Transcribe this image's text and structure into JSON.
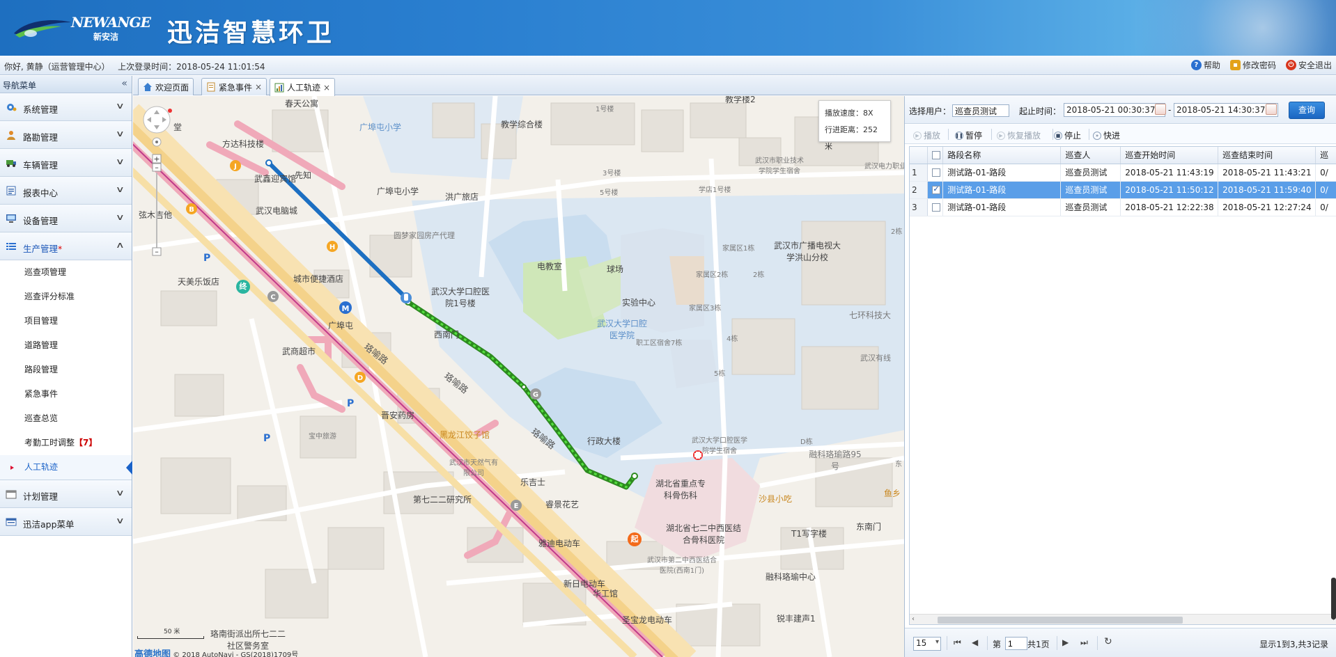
{
  "header": {
    "logo_brand": "NEWANGE",
    "logo_cn": "新安洁",
    "app_title": "迅洁智慧环卫"
  },
  "infobar": {
    "greeting": "你好, 黄静（运营管理中心）",
    "last_login": "上次登录时间：2018-05-24 11:01:54",
    "help": "帮助",
    "change_password": "修改密码",
    "logout": "安全退出"
  },
  "sidebar": {
    "title": "导航菜单",
    "items": [
      {
        "label": "系统管理",
        "icon": "gear-icon"
      },
      {
        "label": "路勘管理",
        "icon": "person-icon"
      },
      {
        "label": "车辆管理",
        "icon": "truck-icon"
      },
      {
        "label": "报表中心",
        "icon": "report-icon"
      },
      {
        "label": "设备管理",
        "icon": "monitor-icon"
      },
      {
        "label": "生产管理",
        "icon": "list-icon",
        "marker": "*"
      }
    ],
    "sub_items": [
      {
        "label": "巡查项管理"
      },
      {
        "label": "巡查评分标准"
      },
      {
        "label": "项目管理"
      },
      {
        "label": "道路管理"
      },
      {
        "label": "路段管理"
      },
      {
        "label": "紧急事件"
      },
      {
        "label": "巡查总览"
      },
      {
        "label": "考勤工时调整",
        "badge": "【7】"
      },
      {
        "label": "人工轨迹"
      }
    ],
    "items_after": [
      {
        "label": "计划管理",
        "icon": "calendar-icon"
      },
      {
        "label": "迅洁app菜单",
        "icon": "app-icon"
      }
    ]
  },
  "tabs": [
    {
      "label": "欢迎页面",
      "closable": false
    },
    {
      "label": "紧急事件",
      "closable": true
    },
    {
      "label": "人工轨迹",
      "closable": true
    }
  ],
  "map": {
    "info": {
      "speed_label": "播放速度：",
      "speed": "8X",
      "distance_label": "行进距离：",
      "distance": "252米"
    },
    "scale": "50 米",
    "copyright_brand": "高德地图",
    "copyright": "© 2018 AutoNavi - GS(2018)1709号",
    "labels": {
      "l1": "方达科技楼",
      "l2": "武鑫迎宾馆",
      "l3": "先知",
      "l4": "武汉电脑城",
      "l5": "弦木吉他",
      "l6": "天美乐饭店",
      "l7": "城市便捷酒店",
      "l8": "广埠屯",
      "l9": "武商超市",
      "l10": "珞喻路",
      "l11": "晋安药房",
      "l12": "宝中旅游",
      "l13": "黑龙江饺子馆",
      "l14": "武汉市天然气有限公司",
      "l15": "第七二二研究所",
      "l16": "乐吉士",
      "l17": "睿景花艺",
      "l18": "雅迪电动车",
      "l19": "新日电动车",
      "l20": "华工馆",
      "l21": "圣宝龙电动车",
      "l22": "珞南街派出所七二二社区警务室",
      "l23": "广埠屯小学",
      "l24": "洪广旅店",
      "l25": "圆梦家园房产代理",
      "l26": "教学综合楼",
      "l27": "春天公寓",
      "l28": "武汉大学口腔医院1号楼",
      "l29": "电教室",
      "l30": "球场",
      "l31": "实验中心",
      "l32": "武汉大学口腔医学院",
      "l33": "西南门",
      "l34": "行政大楼",
      "l35": "湖北省重点专科骨伤科",
      "l36": "湖北省七二中西医结合骨科医院",
      "l37": "武汉市第二中西医结合医院(西南1门)",
      "l38": "沙县小吃",
      "l39": "T1写字楼",
      "l40": "东南门",
      "l41": "融科珞瑜中心",
      "l42": "锐丰建声1",
      "l43": "武汉市广播电视大学洪山分校",
      "l44": "武汉有线",
      "l45": "七环科技大",
      "l46": "融科珞瑜路95号",
      "l47": "武汉市职业技术学院学生宿舍",
      "l48": "家属区1栋",
      "l49": "家属区2栋",
      "l50": "家属区3栋",
      "l51": "职工区宿舍7栋",
      "l52": "武汉大学口腔医学院学生宿舍",
      "l53": "2栋",
      "l54": "4栋",
      "l55": "5栋",
      "l56": "学店1号楼",
      "l57": "3号楼",
      "l58": "5号楼",
      "l59": "1号楼",
      "l60": "教学楼2",
      "l61": "广埠屯小学",
      "l62": "湖北省七二中西医结合骨科医院",
      "l63": "武汉电力职业技术学院",
      "l64": "鱼乡",
      "l65": "东",
      "l66": "D栋",
      "l67": "2栋",
      "l68": "堂"
    },
    "markers": {
      "start": "起",
      "end": "终"
    }
  },
  "query": {
    "user_label": "选择用户：",
    "user_value": "巡查员测试",
    "time_label": "起止时间：",
    "start_time": "2018-05-21 00:30:37",
    "sep": "-",
    "end_time": "2018-05-21 14:30:37",
    "query_button": "查询"
  },
  "playback": {
    "play": "播放",
    "pause": "暂停",
    "resume": "恢复播放",
    "stop": "停止",
    "fast": "快进"
  },
  "grid": {
    "columns": [
      "路段名称",
      "巡查人",
      "巡查开始时间",
      "巡查结束时间",
      "巡"
    ],
    "rows": [
      {
        "num": "1",
        "checked": false,
        "selected": false,
        "cells": [
          "测试路-01-路段",
          "巡查员测试",
          "2018-05-21 11:43:19",
          "2018-05-21 11:43:21",
          "0/"
        ]
      },
      {
        "num": "2",
        "checked": true,
        "selected": true,
        "cells": [
          "测试路-01-路段",
          "巡查员测试",
          "2018-05-21 11:50:12",
          "2018-05-21 11:59:40",
          "0/"
        ]
      },
      {
        "num": "3",
        "checked": false,
        "selected": false,
        "cells": [
          "测试路-01-路段",
          "巡查员测试",
          "2018-05-21 12:22:38",
          "2018-05-21 12:27:24",
          "0/"
        ]
      }
    ]
  },
  "pager": {
    "page_size": "15",
    "page_prefix": "第",
    "page": "1",
    "page_total": "共1页",
    "summary": "显示1到3,共3记录"
  }
}
